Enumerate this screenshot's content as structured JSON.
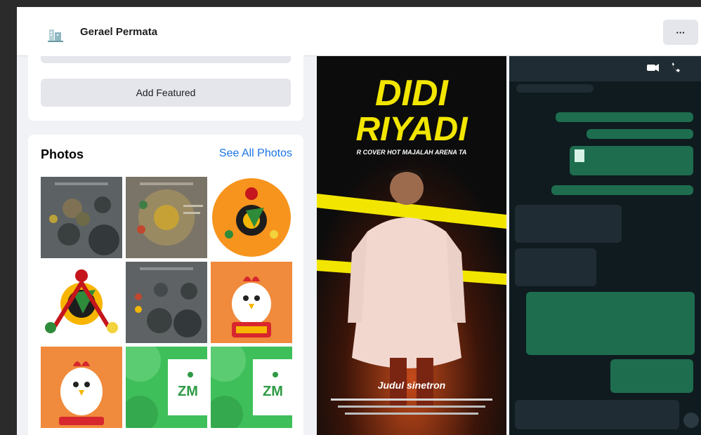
{
  "header": {
    "page_name": "Gerael Permata",
    "more_label": "···",
    "logo_icon": "building-logo-icon"
  },
  "featured": {
    "add_label": "Add Featured"
  },
  "photos": {
    "title": "Photos",
    "see_all_label": "See All Photos",
    "items": [
      {
        "kind": "gray-infographic"
      },
      {
        "kind": "tan-infographic"
      },
      {
        "kind": "orange-gear-logo"
      },
      {
        "kind": "gear-logo-white"
      },
      {
        "kind": "gray-infographic-2"
      },
      {
        "kind": "chicken-mascot-sign"
      },
      {
        "kind": "chicken-mascot"
      },
      {
        "kind": "green-zm-card"
      },
      {
        "kind": "green-zm-card-2"
      }
    ]
  },
  "poster": {
    "title_line1": "DIDI",
    "title_line2": "RIYADI",
    "tagline": "R COVER HOT MAJALAH ARENA TA",
    "caption": "Judul sinetron",
    "accent": "#f2e600"
  },
  "chat": {
    "accent_out": "#1e6d4f",
    "accent_in": "#202c33"
  },
  "colors": {
    "link": "#1b74e4",
    "button_bg": "#e4e6eb",
    "page_bg": "#f0f2f5"
  }
}
